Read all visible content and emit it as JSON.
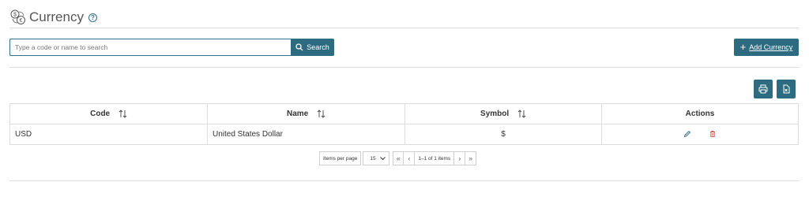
{
  "header": {
    "title": "Currency",
    "help_icon": "question-circle-icon",
    "logo_icon": "currency-exchange-icon"
  },
  "search": {
    "placeholder": "Type a code or name to search",
    "button_label": "Search",
    "button_icon": "search-icon"
  },
  "toolbar": {
    "add_label": "Add Currency",
    "add_icon": "plus-icon",
    "print_icon": "print-icon",
    "export_icon": "excel-export-icon"
  },
  "table": {
    "columns": [
      "Code",
      "Name",
      "Symbol",
      "Actions"
    ],
    "rows": [
      {
        "code": "USD",
        "name": "United States Dollar",
        "symbol": "$",
        "edit_icon": "pencil-icon",
        "delete_icon": "trash-icon"
      }
    ]
  },
  "pager": {
    "items_per_page_label": "Items per page",
    "items_per_page_value": "15",
    "range_label": "1–1 of 1 items"
  },
  "colors": {
    "accent": "#2c6b80",
    "delete": "#d9534f",
    "border": "#dcdcdc"
  }
}
